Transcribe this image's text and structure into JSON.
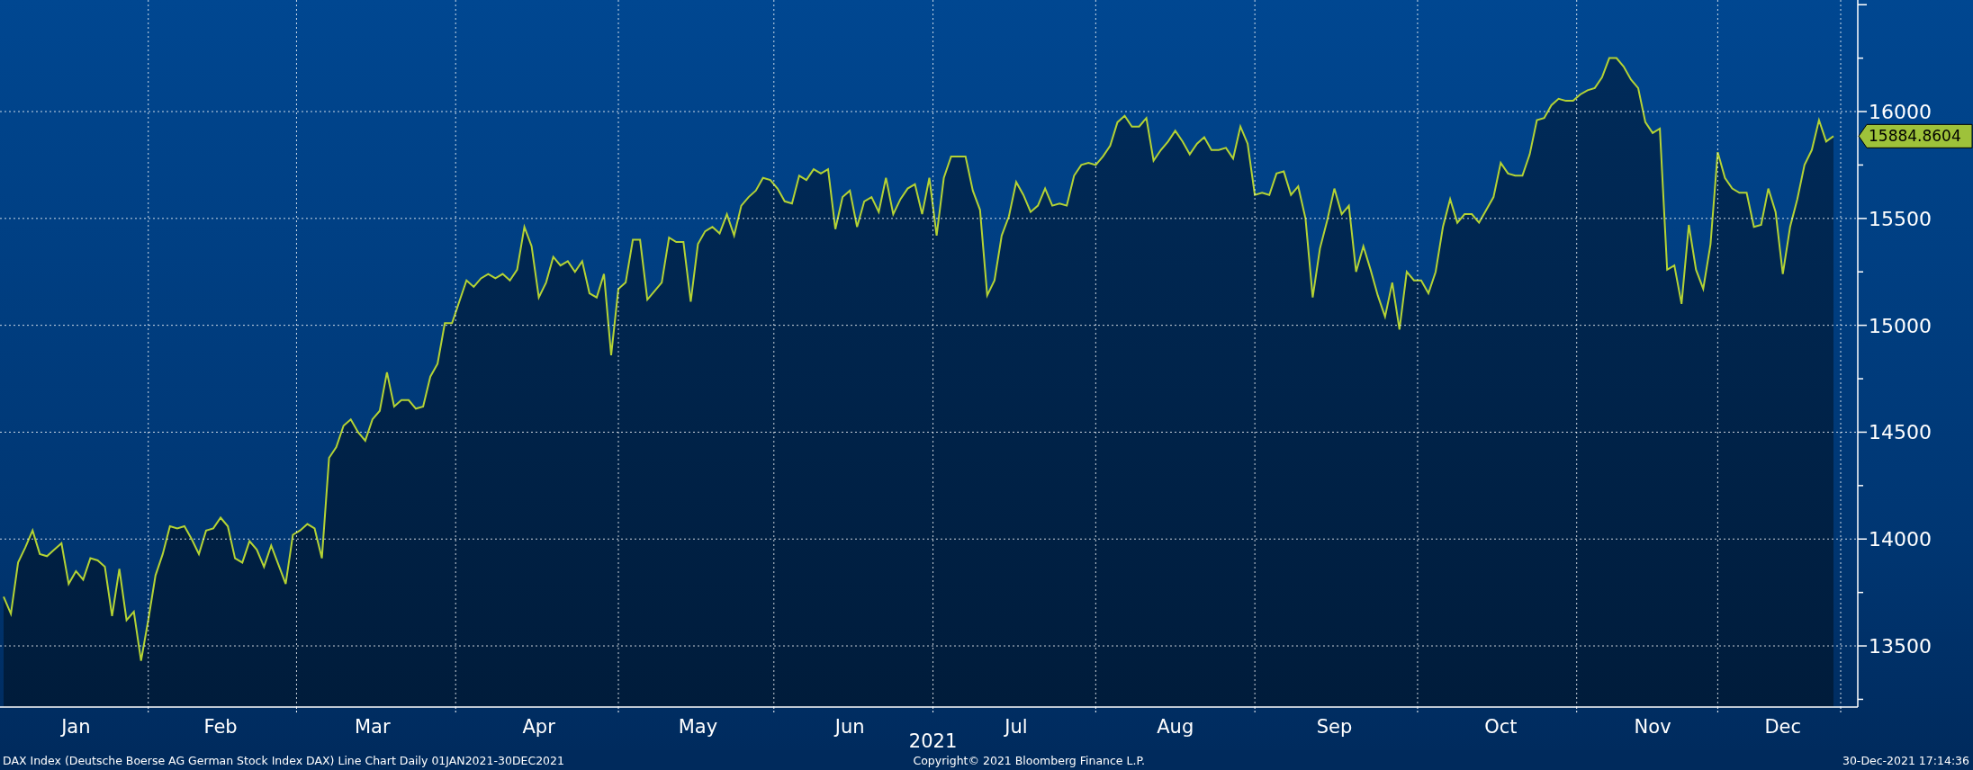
{
  "chart": {
    "chart_data": {
      "type": "area",
      "grid": true,
      "categories": [
        null,
        null,
        null,
        null,
        null,
        null,
        null,
        null,
        null,
        null,
        "Jan",
        null,
        null,
        null,
        null,
        null,
        null,
        null,
        null,
        null,
        null,
        null,
        null,
        null,
        null,
        null,
        null,
        null,
        null,
        null,
        "Feb",
        null,
        null,
        null,
        null,
        null,
        null,
        null,
        null,
        null,
        null,
        null,
        null,
        null,
        null,
        null,
        null,
        null,
        null,
        null,
        null,
        "Mar",
        null,
        null,
        null,
        null,
        null,
        null,
        null,
        null,
        null,
        null,
        null,
        null,
        null,
        null,
        null,
        null,
        null,
        null,
        null,
        null,
        null,
        null,
        "Apr",
        null,
        null,
        null,
        null,
        null,
        null,
        null,
        null,
        null,
        null,
        null,
        null,
        null,
        null,
        null,
        null,
        null,
        null,
        null,
        null,
        null,
        "May",
        null,
        null,
        null,
        null,
        null,
        null,
        null,
        null,
        null,
        null,
        null,
        null,
        null,
        null,
        null,
        null,
        null,
        null,
        null,
        null,
        "Jun",
        null,
        null,
        null,
        null,
        null,
        null,
        null,
        null,
        null,
        null,
        null,
        null,
        null,
        null,
        null,
        null,
        null,
        null,
        null,
        null,
        null,
        null,
        "Jul",
        null,
        null,
        null,
        null,
        null,
        null,
        null,
        null,
        null,
        null,
        null,
        null,
        null,
        null,
        null,
        null,
        null,
        null,
        null,
        null,
        null,
        "Aug",
        null,
        null,
        null,
        null,
        null,
        null,
        null,
        null,
        null,
        null,
        null,
        null,
        null,
        null,
        null,
        null,
        null,
        null,
        null,
        null,
        null,
        "Sep",
        null,
        null,
        null,
        null,
        null,
        null,
        null,
        null,
        null,
        null,
        null,
        null,
        null,
        null,
        null,
        null,
        null,
        null,
        null,
        null,
        null,
        null,
        "Oct",
        null,
        null,
        null,
        null,
        null,
        null,
        null,
        null,
        null,
        null,
        null,
        null,
        null,
        null,
        null,
        null,
        null,
        null,
        null,
        null,
        "Nov",
        null,
        null,
        null,
        null,
        null,
        null,
        null,
        null,
        null,
        null,
        null,
        null,
        null,
        null,
        null,
        null,
        null,
        "Dec",
        null,
        null,
        null,
        null,
        null,
        null,
        null
      ],
      "title": "DAX Index (Deutsche Boerse AG German Stock Index DAX) Line Chart  Daily 01JAN2021-30DEC2021",
      "xlabel": "2021",
      "ylim": [
        13214,
        16522
      ],
      "yticks": [
        13500,
        14000,
        14500,
        15000,
        15500,
        16000
      ],
      "series": [
        {
          "color": "#b4d334",
          "values": [
            13730,
            13650,
            13890,
            13960,
            14040,
            13930,
            13920,
            13950,
            13980,
            13790,
            13850,
            13810,
            13910,
            13900,
            13870,
            13640,
            13860,
            13620,
            13660,
            13430,
            13620,
            13830,
            13930,
            14060,
            14050,
            14060,
            14000,
            13930,
            14040,
            14050,
            14100,
            14060,
            13910,
            13890,
            13990,
            13950,
            13870,
            13970,
            13880,
            13790,
            14020,
            14040,
            14070,
            14050,
            13910,
            14380,
            14430,
            14530,
            14560,
            14500,
            14460,
            14560,
            14600,
            14780,
            14620,
            14650,
            14650,
            14610,
            14620,
            14760,
            14820,
            15010,
            15010,
            15110,
            15210,
            15180,
            15220,
            15240,
            15220,
            15240,
            15210,
            15260,
            15460,
            15370,
            15130,
            15200,
            15320,
            15280,
            15300,
            15250,
            15300,
            15150,
            15130,
            15240,
            14860,
            15170,
            15200,
            15400,
            15400,
            15120,
            15160,
            15200,
            15410,
            15390,
            15390,
            15110,
            15380,
            15440,
            15460,
            15430,
            15520,
            15420,
            15560,
            15600,
            15630,
            15690,
            15680,
            15640,
            15580,
            15570,
            15700,
            15680,
            15730,
            15710,
            15730,
            15450,
            15600,
            15630,
            15460,
            15580,
            15600,
            15530,
            15690,
            15520,
            15590,
            15640,
            15660,
            15520,
            15690,
            15420,
            15690,
            15790,
            15790,
            15790,
            15630,
            15540,
            15140,
            15210,
            15420,
            15510,
            15670,
            15610,
            15530,
            15560,
            15640,
            15560,
            15570,
            15560,
            15700,
            15750,
            15760,
            15750,
            15790,
            15840,
            15950,
            15980,
            15930,
            15930,
            15970,
            15770,
            15820,
            15860,
            15910,
            15860,
            15800,
            15850,
            15880,
            15820,
            15820,
            15830,
            15780,
            15930,
            15850,
            15610,
            15620,
            15610,
            15710,
            15720,
            15610,
            15650,
            15500,
            15130,
            15360,
            15490,
            15640,
            15520,
            15560,
            15250,
            15370,
            15260,
            15140,
            15040,
            15200,
            14980,
            15250,
            15210,
            15210,
            15150,
            15250,
            15460,
            15590,
            15480,
            15520,
            15520,
            15480,
            15540,
            15600,
            15760,
            15710,
            15700,
            15700,
            15800,
            15960,
            15970,
            16030,
            16060,
            16050,
            16050,
            16080,
            16100,
            16110,
            16160,
            16250,
            16250,
            16210,
            16150,
            16110,
            15950,
            15900,
            15920,
            15260,
            15280,
            15100,
            15470,
            15260,
            15170,
            15380,
            15810,
            15690,
            15640,
            15620,
            15620,
            15460,
            15470,
            15640,
            15530,
            15240,
            15460,
            15590,
            15750,
            15820,
            15960,
            15860,
            15885
          ]
        }
      ],
      "annotations": [
        "15884.8604"
      ]
    }
  },
  "footer": {
    "copyright": "Copyright© 2021 Bloomberg Finance L.P.",
    "timestamp": "30-Dec-2021 17:14:36"
  }
}
